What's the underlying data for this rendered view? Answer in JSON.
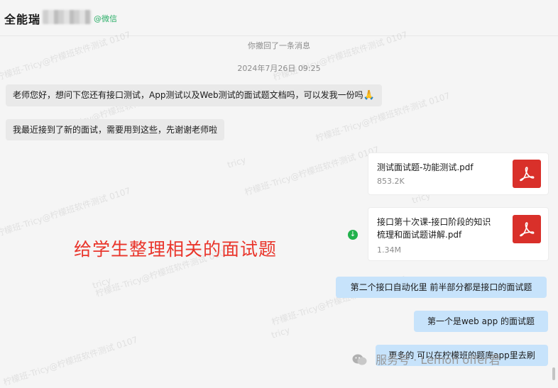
{
  "header": {
    "contact_name": "全能瑞",
    "wechat_tag": "@微信"
  },
  "watermark": {
    "text": "柠檬班-Tricy@柠檬班软件测试 0107",
    "short": "tricy"
  },
  "messages": {
    "recall_notice": "你撤回了一条消息",
    "timestamp": "2024年7月26日 09:25",
    "left_1": "老师您好，想问下您还有接口测试，App测试以及Web测试的面试题文档吗，可以发我一份吗",
    "left_1_emoji": "🙏",
    "left_2": "我最近接到了新的面试，需要用到这些，先谢谢老师啦",
    "file_1": {
      "name": "测试面试题-功能测试.pdf",
      "size": "853.2K",
      "icon": "pdf-icon"
    },
    "file_2": {
      "name_line1": "接口第十次课-接口阶段的知识",
      "name_line2": "梳理和面试题讲解.pdf",
      "size": "1.34M",
      "icon": "pdf-icon"
    },
    "download_icon": "download-complete-icon",
    "right_1": "第二个接口自动化里 前半部分都是接口的面试题",
    "right_2": "第一个是web app  的面试题",
    "right_3": "更多的 可以在柠檬班的题库app里去刷"
  },
  "annotation": "给学生整理相关的面试题",
  "footer": {
    "text": "服务号 · Lemon offer君"
  },
  "colors": {
    "bubble_left": "#e9e9e9",
    "bubble_right": "#c7e3fb",
    "pdf_red": "#d9302a",
    "annotation_red": "#e9352b",
    "wechat_green": "#2aae67"
  }
}
